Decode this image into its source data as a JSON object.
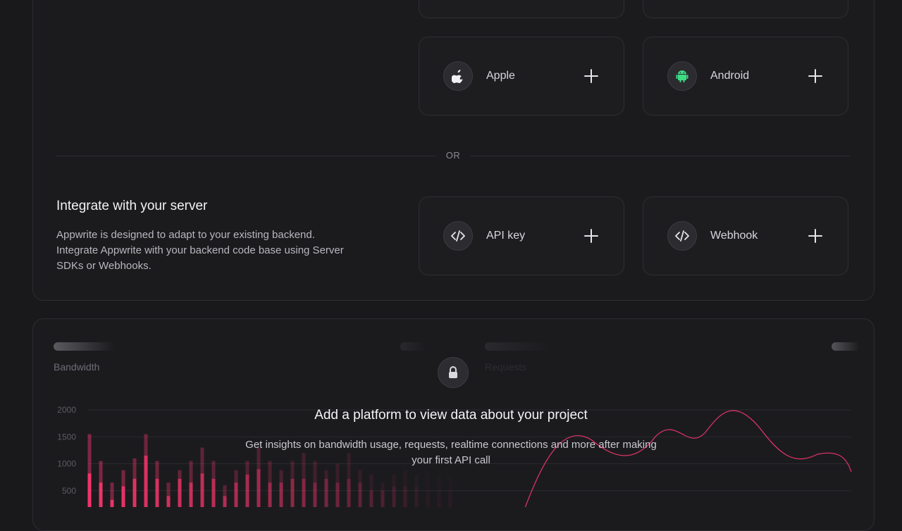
{
  "platforms": {
    "apple": {
      "label": "Apple"
    },
    "android": {
      "label": "Android"
    }
  },
  "divider": {
    "label": "OR"
  },
  "server": {
    "title": "Integrate with your server",
    "description": "Appwrite is designed to adapt to your existing backend. Integrate Appwrite with your backend code base using Server SDKs or Webhooks.",
    "api_key": {
      "label": "API key"
    },
    "webhook": {
      "label": "Webhook"
    }
  },
  "usage": {
    "bandwidth_label": "Bandwidth",
    "requests_label": "Requests",
    "locked_title": "Add a platform to view data about your project",
    "locked_description": "Get insights on bandwidth usage, requests, realtime connections and more after making your first API call"
  },
  "colors": {
    "accent": "#fd366e",
    "android_green": "#3ddc84"
  },
  "chart_data": {
    "type": "bar",
    "title": "",
    "xlabel": "",
    "ylabel": "Bandwidth",
    "ylim": [
      0,
      2000
    ],
    "yticks": [
      2000,
      1500,
      1000,
      500
    ],
    "grid": true,
    "series": [
      {
        "values": [
          1550,
          1050,
          650,
          880,
          1100,
          1550,
          1050,
          650,
          880,
          1050,
          1300,
          1050,
          600,
          880,
          1050,
          1300,
          1050,
          880,
          1050,
          1200,
          1050,
          880,
          1000,
          1200,
          880,
          800,
          650,
          800,
          880,
          800,
          880,
          800,
          800
        ]
      },
      {
        "values": [
          820,
          650,
          330,
          580,
          720,
          1150,
          720,
          400,
          720,
          650,
          820,
          720,
          400,
          650,
          800,
          900,
          650,
          650,
          720,
          720,
          650,
          720,
          650,
          720,
          650,
          500,
          500,
          580,
          580,
          580,
          500,
          500,
          500
        ]
      }
    ]
  }
}
